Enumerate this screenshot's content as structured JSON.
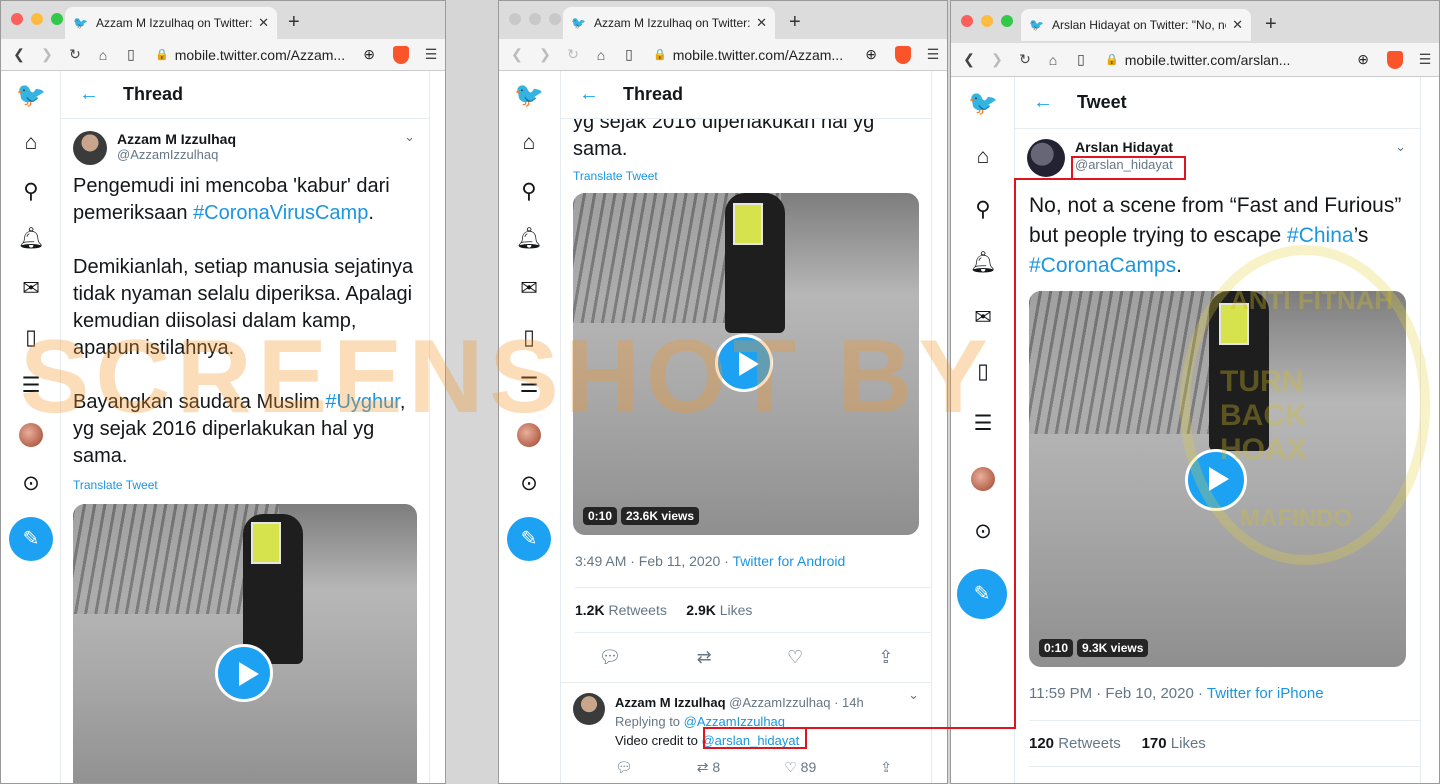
{
  "windows": [
    {
      "tab_title": "Azzam M Izzulhaq on Twitter: \"Pen",
      "url": "mobile.twitter.com/Azzam...",
      "header": "Thread",
      "author_name": "Azzam M Izzulhaq",
      "author_handle": "@AzzamIzzulhaq",
      "paragraphs": [
        [
          "Pengemudi ini mencoba 'kabur' dari pemeriksaan ",
          "#CoronaVirusCamp",
          "."
        ],
        [
          "Demikianlah, setiap manusia sejatinya tidak nyaman selalu diperiksa. Apalagi kemudian diisolasi dalam kamp, apapun istilahnya.",
          "",
          ""
        ],
        [
          "Bayangkan saudara Muslim ",
          "#Uyghur",
          ", yg sejak 2016 diperlakukan hal yg sama."
        ]
      ],
      "translate": "Translate Tweet"
    },
    {
      "tab_title": "Azzam M Izzulhaq on Twitter: \"Pe",
      "url": "mobile.twitter.com/Azzam...",
      "header": "Thread",
      "partial_text": "yg sejak 2016 diperlakukan hal yg sama.",
      "translate": "Translate Tweet",
      "video_time": "0:10",
      "video_views": "23.6K views",
      "timestamp": "3:49 AM · Feb 11, 2020 · ",
      "source": "Twitter for Android",
      "retweets_count": "1.2K",
      "retweets_label": "Retweets",
      "likes_count": "2.9K",
      "likes_label": "Likes",
      "reply": {
        "name": "Azzam M Izzulhaq",
        "handle_time": "@AzzamIzzulhaq · 14h",
        "replying_prefix": "Replying to ",
        "replying_to": "@AzzamIzzulhaq",
        "credit_prefix": "Video credit to ",
        "credit_handle": "@arslan_hidayat",
        "retweet_count": "8",
        "like_count": "89"
      }
    },
    {
      "tab_title": "Arslan Hidayat on Twitter: \"No, not",
      "url": "mobile.twitter.com/arslan...",
      "header": "Tweet",
      "author_name": "Arslan Hidayat",
      "author_handle": "@arslan_hidayat",
      "text_parts": [
        "No, not a scene from “Fast and Furious” but people trying to escape ",
        "#China",
        "’s ",
        "#CoronaCamps",
        "."
      ],
      "video_time": "0:10",
      "video_views": "9.3K views",
      "timestamp": "11:59 PM · Feb 10, 2020 · ",
      "source": "Twitter for iPhone",
      "retweets_count": "120",
      "retweets_label": "Retweets",
      "likes_count": "170",
      "likes_label": "Likes"
    }
  ],
  "overlay": {
    "watermark": "SCREENSHOT BY",
    "seal_top": "ANTI FITNAH",
    "seal_middle": "TURN BACK HOAX",
    "seal_bottom": "MAFINDO"
  },
  "colors": {
    "twitter_blue": "#1da1f2",
    "highlight_red": "#e0141e"
  }
}
